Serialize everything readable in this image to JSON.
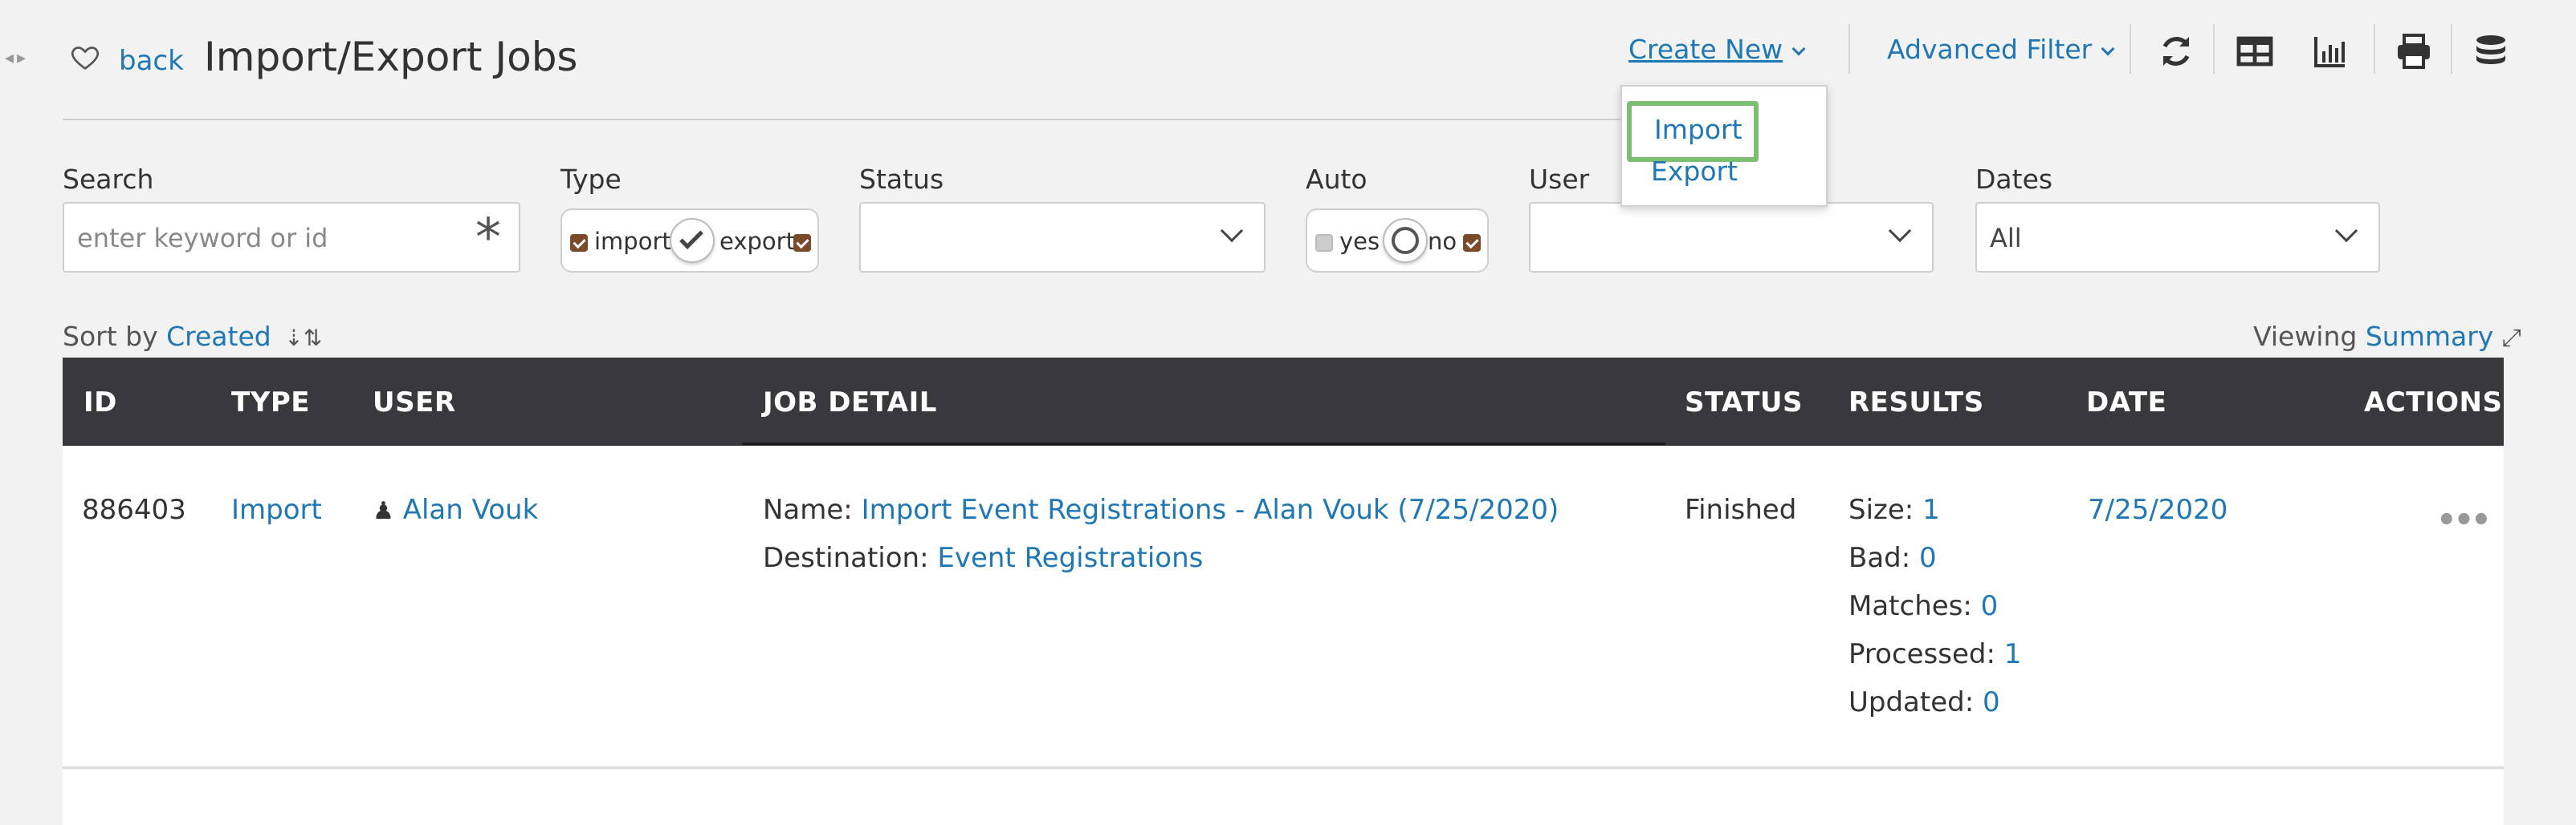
{
  "header": {
    "back_label": "back",
    "title": "Import/Export Jobs",
    "create_new_label": "Create New",
    "advanced_filter_label": "Advanced Filter",
    "tools": [
      "refresh-icon",
      "table-icon",
      "bar-chart-icon",
      "print-icon",
      "database-icon"
    ]
  },
  "create_menu": {
    "items": [
      "Import",
      "Export"
    ]
  },
  "filters": {
    "search": {
      "label": "Search",
      "placeholder": "enter keyword or id"
    },
    "type": {
      "label": "Type",
      "left": "import",
      "right": "export"
    },
    "status": {
      "label": "Status",
      "value": ""
    },
    "auto": {
      "label": "Auto",
      "left": "yes",
      "right": "no"
    },
    "user": {
      "label": "User",
      "value": ""
    },
    "dates": {
      "label": "Dates",
      "value": "All"
    }
  },
  "sort": {
    "prefix": "Sort by",
    "field": "Created"
  },
  "viewing": {
    "prefix": "Viewing",
    "mode": "Summary"
  },
  "table": {
    "columns": [
      "ID",
      "TYPE",
      "USER",
      "JOB DETAIL",
      "STATUS",
      "RESULTS",
      "DATE",
      "ACTIONS"
    ],
    "rows": [
      {
        "id": "886403",
        "type": "Import",
        "user": "Alan Vouk",
        "name_label": "Name:",
        "name": "Import Event Registrations - Alan Vouk (7/25/2020)",
        "dest_label": "Destination:",
        "destination": "Event Registrations",
        "status": "Finished",
        "results": [
          {
            "label": "Size:",
            "value": "1"
          },
          {
            "label": "Bad:",
            "value": "0"
          },
          {
            "label": "Matches:",
            "value": "0"
          },
          {
            "label": "Processed:",
            "value": "1"
          },
          {
            "label": "Updated:",
            "value": "0"
          }
        ],
        "date": "7/25/2020"
      }
    ]
  },
  "colors": {
    "accent": "#1f77b4",
    "table_header": "#38383d",
    "highlight": "#7cbf72",
    "checkbox": "#7a4a2a"
  }
}
